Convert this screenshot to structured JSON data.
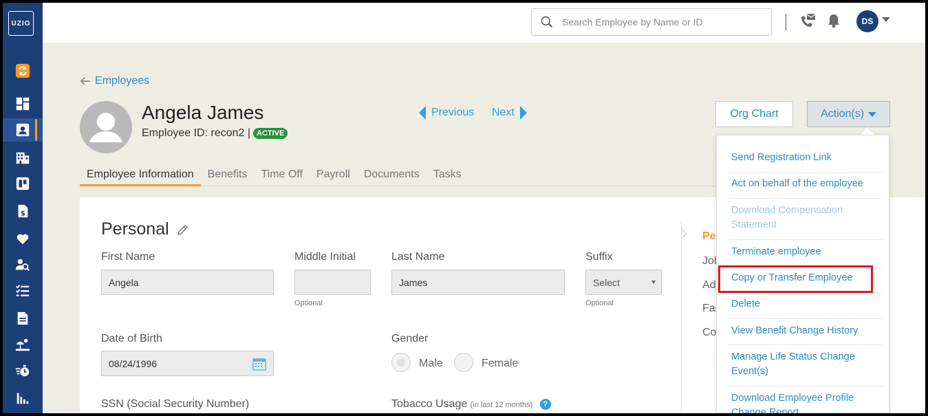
{
  "app": {
    "logo_text": "UZIO"
  },
  "sidebar": {
    "items": [
      {
        "icon": "sync-icon"
      },
      {
        "icon": "dashboard-icon"
      },
      {
        "icon": "employee-card-icon",
        "active": true
      },
      {
        "icon": "building-icon"
      },
      {
        "icon": "board-icon"
      },
      {
        "icon": "payroll-document-icon"
      },
      {
        "icon": "heart-icon"
      },
      {
        "icon": "user-search-icon"
      },
      {
        "icon": "checklist-icon"
      },
      {
        "icon": "document-icon"
      },
      {
        "icon": "beach-icon"
      },
      {
        "icon": "stopwatch-icon"
      },
      {
        "icon": "reports-icon"
      }
    ]
  },
  "header": {
    "search_placeholder": "Search Employee by Name or ID",
    "user_initials": "DS"
  },
  "breadcrumb": {
    "label": "Employees"
  },
  "employee": {
    "name": "Angela James",
    "id_label": "Employee ID: recon2 |",
    "status": "ACTIVE"
  },
  "pager": {
    "previous": "Previous",
    "next": "Next"
  },
  "buttons": {
    "org_chart": "Org Chart",
    "actions": "Action(s)"
  },
  "tabs": [
    "Employee Information",
    "Benefits",
    "Time Off",
    "Payroll",
    "Documents",
    "Tasks"
  ],
  "personal": {
    "title": "Personal",
    "first_name_label": "First Name",
    "first_name_value": "Angela",
    "middle_initial_label": "Middle Initial",
    "middle_initial_value": "",
    "middle_hint": "Optional",
    "last_name_label": "Last Name",
    "last_name_value": "James",
    "suffix_label": "Suffix",
    "suffix_value": "Select",
    "suffix_hint": "Optional",
    "dob_label": "Date of Birth",
    "dob_value": "08/24/1996",
    "gender_label": "Gender",
    "gender_male": "Male",
    "gender_female": "Female",
    "ssn_label": "SSN (Social Security Number)",
    "tobacco_label": "Tobacco Usage",
    "tobacco_note": "(in last 12 months)",
    "help": "?"
  },
  "side_nav": [
    "Per",
    "Job",
    "Add",
    "Far",
    "Co"
  ],
  "actions_menu": [
    {
      "label": "Send Registration Link"
    },
    {
      "label": "Act on behalf of the employee"
    },
    {
      "label": "Download Compensation Statement",
      "disabled": true
    },
    {
      "label": "Terminate employee"
    },
    {
      "label": "Copy or Transfer Employee",
      "highlighted": true
    },
    {
      "label": "Delete"
    },
    {
      "label": "View Benefit Change History"
    },
    {
      "label": "Manage Life Status Change Event(s)"
    },
    {
      "label": "Download Employee Profile Change Report"
    }
  ],
  "colors": {
    "sidebar": "#1d3f78",
    "accent": "#f39c2c",
    "link": "#2f8bc4",
    "status_green": "#2d8f3e",
    "highlight": "#e0161d"
  }
}
